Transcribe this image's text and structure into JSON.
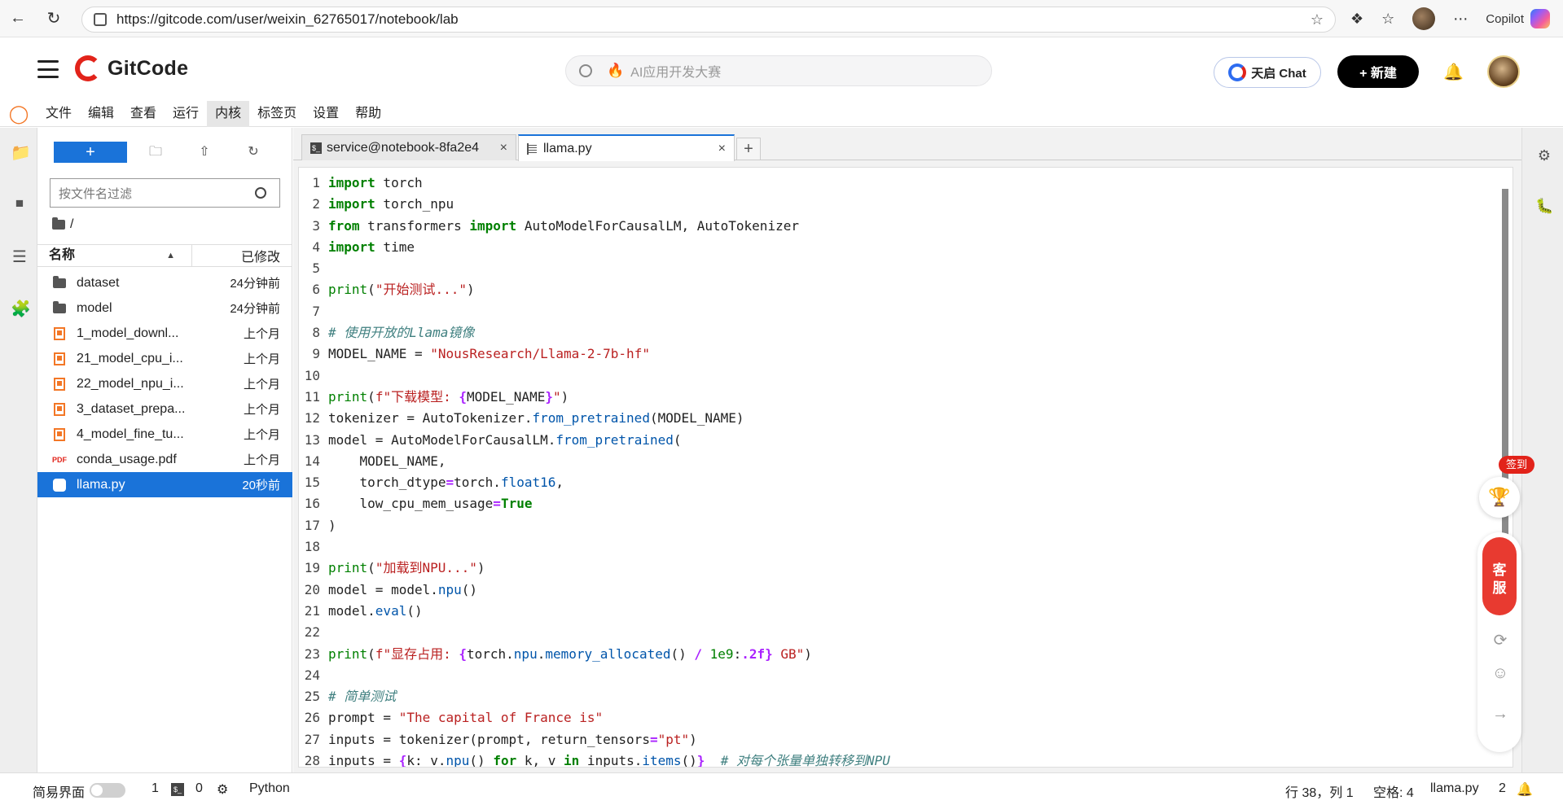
{
  "browser": {
    "url": "https://gitcode.com/user/weixin_62765017/notebook/lab",
    "copilot_label": "Copilot"
  },
  "header": {
    "brand": "GitCode",
    "search_placeholder": "AI应用开发大赛",
    "chat_label": "天启 Chat",
    "new_label": "+ 新建"
  },
  "menu": {
    "items": [
      "文件",
      "编辑",
      "查看",
      "运行",
      "内核",
      "标签页",
      "设置",
      "帮助"
    ],
    "active_index": 4
  },
  "file_browser": {
    "filter_placeholder": "按文件名过滤",
    "path": "/",
    "col_name": "名称",
    "col_modified": "已修改",
    "files": [
      {
        "name": "dataset",
        "modified": "24分钟前",
        "type": "folder"
      },
      {
        "name": "model",
        "modified": "24分钟前",
        "type": "folder"
      },
      {
        "name": "1_model_downl...",
        "modified": "上个月",
        "type": "notebook"
      },
      {
        "name": "21_model_cpu_i...",
        "modified": "上个月",
        "type": "notebook"
      },
      {
        "name": "22_model_npu_i...",
        "modified": "上个月",
        "type": "notebook"
      },
      {
        "name": "3_dataset_prepa...",
        "modified": "上个月",
        "type": "notebook"
      },
      {
        "name": "4_model_fine_tu...",
        "modified": "上个月",
        "type": "notebook"
      },
      {
        "name": "conda_usage.pdf",
        "modified": "上个月",
        "type": "pdf"
      },
      {
        "name": "llama.py",
        "modified": "20秒前",
        "type": "python",
        "selected": true
      }
    ]
  },
  "tabs": [
    {
      "label": "service@notebook-8fa2e4",
      "type": "terminal"
    },
    {
      "label": "llama.py",
      "type": "file",
      "active": true
    }
  ],
  "float_widget": {
    "sign_label": "签到",
    "service_label_1": "客",
    "service_label_2": "服"
  },
  "statusbar": {
    "simple_mode": "简易界面",
    "kernel_count": "1",
    "terminal_count": "0",
    "language": "Python",
    "cursor_pos": "行 38，列 1",
    "indent": "空格: 4",
    "filename": "llama.py",
    "notifications": "2"
  }
}
